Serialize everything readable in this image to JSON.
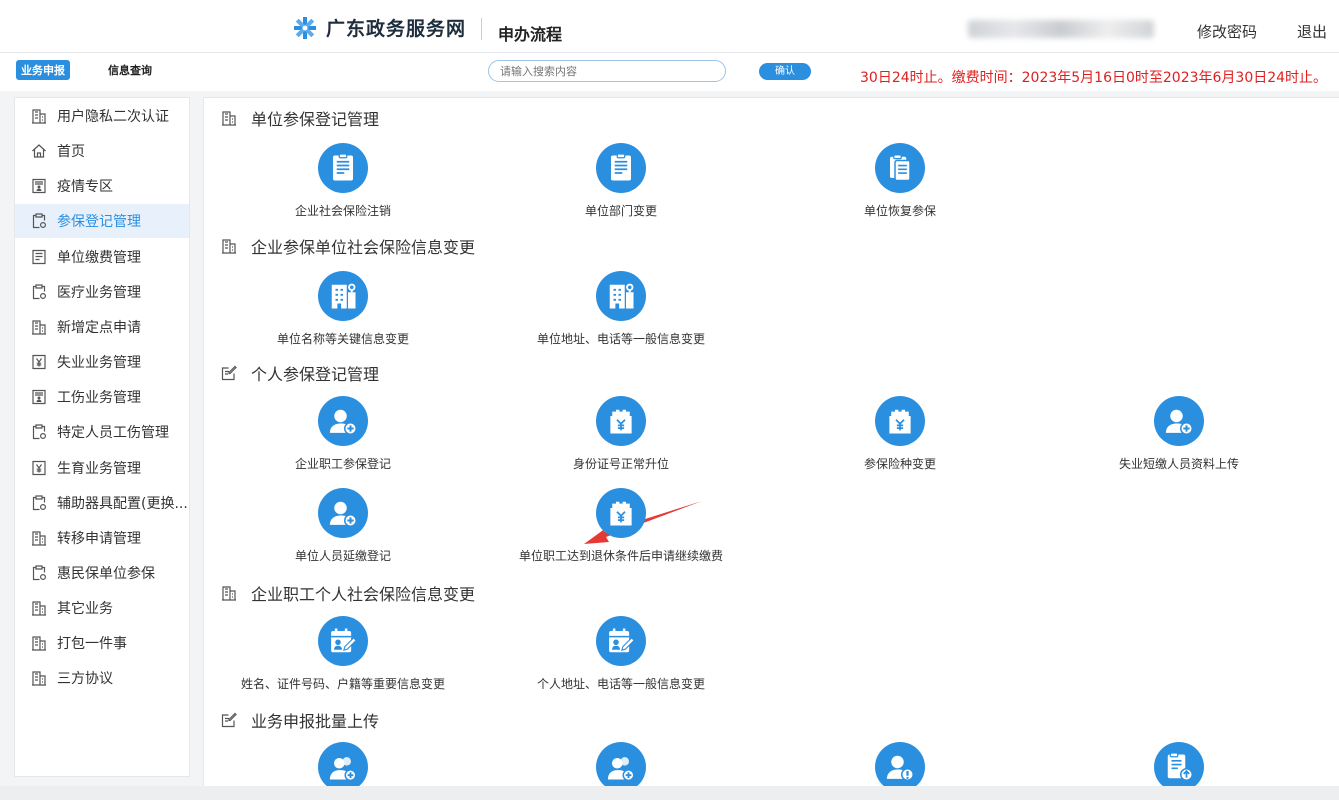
{
  "header": {
    "site_title": "广东政务服务网",
    "page_tag": "申办流程",
    "change_password": "修改密码",
    "logout": "退出"
  },
  "toolbar": {
    "tab_active": "业务申报",
    "tab_info": "信息查询",
    "search_placeholder": "请输入搜索内容",
    "confirm": "确认",
    "notice": "30日24时止。缴费时间：2023年5月16日0时至2023年6月30日24时止。"
  },
  "sidebar": {
    "items": [
      {
        "label": "用户隐私二次认证",
        "icon": "building-icon"
      },
      {
        "label": "首页",
        "icon": "home-icon"
      },
      {
        "label": "疫情专区",
        "icon": "document-person-icon"
      },
      {
        "label": "参保登记管理",
        "icon": "clipboard-gear-icon",
        "active": true
      },
      {
        "label": "单位缴费管理",
        "icon": "form-icon"
      },
      {
        "label": "医疗业务管理",
        "icon": "clipboard-gear-icon"
      },
      {
        "label": "新增定点申请",
        "icon": "building-icon"
      },
      {
        "label": "失业业务管理",
        "icon": "yuan-doc-icon"
      },
      {
        "label": "工伤业务管理",
        "icon": "document-person-icon"
      },
      {
        "label": "特定人员工伤管理",
        "icon": "clipboard-gear-icon"
      },
      {
        "label": "生育业务管理",
        "icon": "yuan-doc-icon"
      },
      {
        "label": "辅助器具配置(更换...",
        "icon": "clipboard-gear-icon"
      },
      {
        "label": "转移申请管理",
        "icon": "building-icon"
      },
      {
        "label": "惠民保单位参保",
        "icon": "clipboard-gear-icon"
      },
      {
        "label": "其它业务",
        "icon": "building-icon"
      },
      {
        "label": "打包一件事",
        "icon": "building-icon"
      },
      {
        "label": "三方协议",
        "icon": "building-icon"
      }
    ]
  },
  "sections": [
    {
      "title": "单位参保登记管理",
      "icon": "building-icon",
      "items": [
        {
          "label": "企业社会保险注销",
          "icon": "document-icon"
        },
        {
          "label": "单位部门变更",
          "icon": "document-icon"
        },
        {
          "label": "单位恢复参保",
          "icon": "clipboard-copy-icon"
        }
      ]
    },
    {
      "title": "企业参保单位社会保险信息变更",
      "icon": "building-icon",
      "items": [
        {
          "label": "单位名称等关键信息变更",
          "icon": "building-key-icon"
        },
        {
          "label": "单位地址、电话等一般信息变更",
          "icon": "building-key-icon"
        }
      ]
    },
    {
      "title": "个人参保登记管理",
      "icon": "edit-icon",
      "items": [
        {
          "label": "企业职工参保登记",
          "icon": "user-add-icon"
        },
        {
          "label": "身份证号正常升位",
          "icon": "yuan-badge-icon"
        },
        {
          "label": "参保险种变更",
          "icon": "yuan-badge-icon"
        },
        {
          "label": "失业短缴人员资料上传",
          "icon": "user-add-icon"
        },
        {
          "label": "单位人员延缴登记",
          "icon": "user-add-icon"
        },
        {
          "label": "单位职工达到退休条件后申请继续缴费",
          "icon": "yuan-badge-icon"
        }
      ]
    },
    {
      "title": "企业职工个人社会保险信息变更",
      "icon": "building-icon",
      "items": [
        {
          "label": "姓名、证件号码、户籍等重要信息变更",
          "icon": "calendar-edit-icon"
        },
        {
          "label": "个人地址、电话等一般信息变更",
          "icon": "calendar-edit-icon"
        }
      ]
    },
    {
      "title": "业务申报批量上传",
      "icon": "edit-icon",
      "items": [
        {
          "label": "",
          "icon": "users-add-icon"
        },
        {
          "label": "",
          "icon": "users-add-icon"
        },
        {
          "label": "",
          "icon": "user-alert-icon"
        },
        {
          "label": "",
          "icon": "document-upload-icon"
        }
      ]
    }
  ],
  "colors": {
    "accent": "#2b8fe0",
    "notice": "#e02020",
    "arrow": "#e53935"
  }
}
